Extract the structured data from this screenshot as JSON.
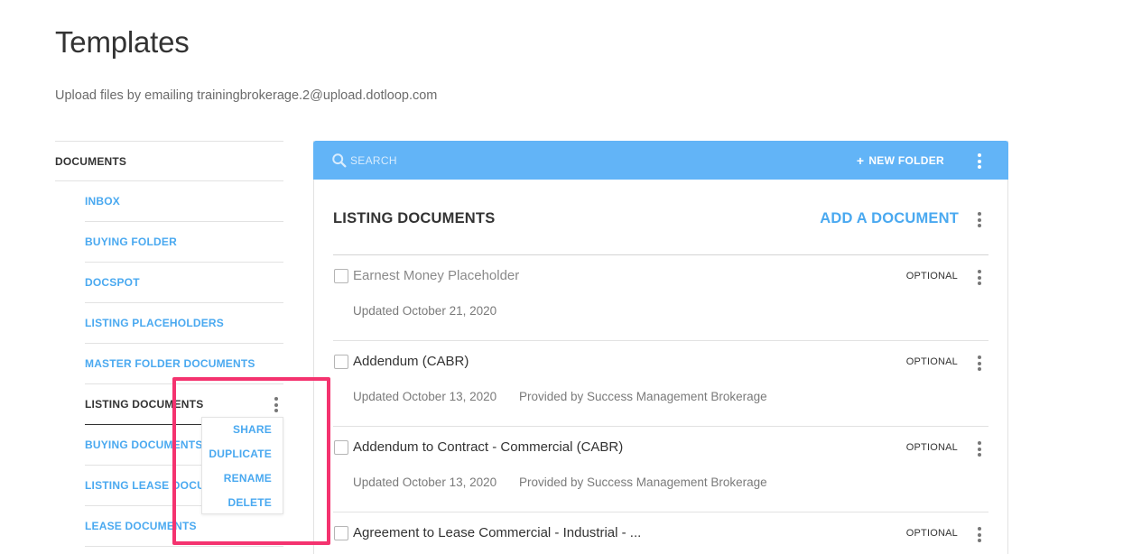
{
  "page": {
    "title": "Templates",
    "subtitle": "Upload files by emailing trainingbrokerage.2@upload.dotloop.com"
  },
  "sidebar": {
    "header": "DOCUMENTS",
    "items": [
      {
        "label": "INBOX"
      },
      {
        "label": "BUYING FOLDER"
      },
      {
        "label": "DOCSPOT"
      },
      {
        "label": "LISTING PLACEHOLDERS"
      },
      {
        "label": "MASTER FOLDER DOCUMENTS"
      },
      {
        "label": "LISTING DOCUMENTS",
        "active": true
      },
      {
        "label": "BUYING DOCUMENTS"
      },
      {
        "label": "LISTING LEASE DOCUMENTS"
      },
      {
        "label": "LEASE DOCUMENTS"
      }
    ]
  },
  "context_menu": {
    "items": [
      "SHARE",
      "DUPLICATE",
      "RENAME",
      "DELETE"
    ]
  },
  "toolbar": {
    "search_placeholder": "SEARCH",
    "new_folder_label": "NEW FOLDER",
    "new_folder_icon": "plus-icon"
  },
  "folder": {
    "title": "LISTING DOCUMENTS",
    "add_label": "ADD A DOCUMENT"
  },
  "documents": [
    {
      "name": "Earnest Money Placeholder",
      "status": "OPTIONAL",
      "updated": "Updated October 21, 2020",
      "provider": "",
      "muted": true
    },
    {
      "name": "Addendum (CABR)",
      "status": "OPTIONAL",
      "updated": "Updated October 13, 2020",
      "provider": "Provided by Success Management Brokerage"
    },
    {
      "name": "Addendum to Contract - Commercial (CABR)",
      "status": "OPTIONAL",
      "updated": "Updated October 13, 2020",
      "provider": "Provided by Success Management Brokerage"
    },
    {
      "name": "Agreement to Lease Commercial - Industrial - ...",
      "status": "OPTIONAL",
      "updated": "",
      "provider": ""
    }
  ],
  "colors": {
    "accent": "#4aa9f0",
    "bar": "#62b4f7",
    "highlight": "#f4336f"
  }
}
